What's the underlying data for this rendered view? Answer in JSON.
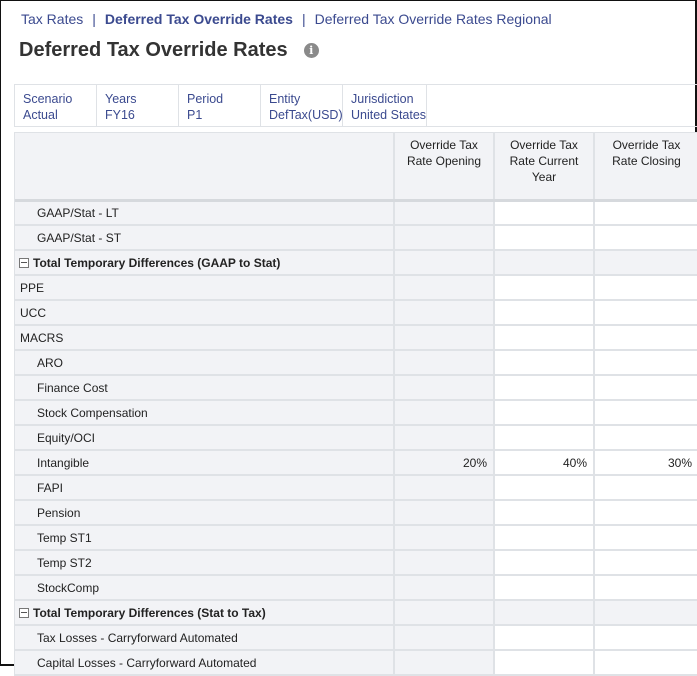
{
  "nav": {
    "links": [
      {
        "label": "Tax Rates",
        "active": false
      },
      {
        "label": "Deferred Tax Override Rates",
        "active": true
      },
      {
        "label": "Deferred Tax Override Rates Regional",
        "active": false
      }
    ],
    "separator": "|"
  },
  "page": {
    "title": "Deferred Tax Override Rates",
    "info_icon": "i"
  },
  "pov": [
    {
      "dimension": "Scenario",
      "member": "Actual"
    },
    {
      "dimension": "Years",
      "member": "FY16"
    },
    {
      "dimension": "Period",
      "member": "P1"
    },
    {
      "dimension": "Entity",
      "member": "DefTax(USD)"
    },
    {
      "dimension": "Jurisdiction",
      "member": "United States"
    }
  ],
  "grid": {
    "columns": [
      "Override Tax Rate Opening",
      "Override Tax Rate Current Year",
      "Override Tax Rate Closing"
    ],
    "rows": [
      {
        "label": "GAAP/Stat - LT",
        "indent": true,
        "section": false,
        "values": [
          "",
          "",
          ""
        ]
      },
      {
        "label": "GAAP/Stat - ST",
        "indent": true,
        "section": false,
        "values": [
          "",
          "",
          ""
        ]
      },
      {
        "label": "Total Temporary Differences (GAAP to Stat)",
        "indent": false,
        "section": true,
        "values": [
          "",
          "",
          ""
        ]
      },
      {
        "label": "PPE",
        "indent": false,
        "section": false,
        "values": [
          "",
          "",
          ""
        ]
      },
      {
        "label": "UCC",
        "indent": false,
        "section": false,
        "values": [
          "",
          "",
          ""
        ]
      },
      {
        "label": "MACRS",
        "indent": false,
        "section": false,
        "values": [
          "",
          "",
          ""
        ]
      },
      {
        "label": "ARO",
        "indent": true,
        "section": false,
        "values": [
          "",
          "",
          ""
        ]
      },
      {
        "label": "Finance Cost",
        "indent": true,
        "section": false,
        "values": [
          "",
          "",
          ""
        ]
      },
      {
        "label": "Stock Compensation",
        "indent": true,
        "section": false,
        "values": [
          "",
          "",
          ""
        ]
      },
      {
        "label": "Equity/OCI",
        "indent": true,
        "section": false,
        "values": [
          "",
          "",
          ""
        ]
      },
      {
        "label": "Intangible",
        "indent": true,
        "section": false,
        "values": [
          "20%",
          "40%",
          "30%"
        ]
      },
      {
        "label": "FAPI",
        "indent": true,
        "section": false,
        "values": [
          "",
          "",
          ""
        ]
      },
      {
        "label": "Pension",
        "indent": true,
        "section": false,
        "values": [
          "",
          "",
          ""
        ]
      },
      {
        "label": "Temp ST1",
        "indent": true,
        "section": false,
        "values": [
          "",
          "",
          ""
        ]
      },
      {
        "label": "Temp ST2",
        "indent": true,
        "section": false,
        "values": [
          "",
          "",
          ""
        ]
      },
      {
        "label": "StockComp",
        "indent": true,
        "section": false,
        "values": [
          "",
          "",
          ""
        ]
      },
      {
        "label": "Total Temporary Differences (Stat to Tax)",
        "indent": false,
        "section": true,
        "values": [
          "",
          "",
          ""
        ]
      },
      {
        "label": "Tax Losses - Carryforward Automated",
        "indent": true,
        "section": false,
        "values": [
          "",
          "",
          ""
        ]
      },
      {
        "label": "Capital Losses - Carryforward Automated",
        "indent": true,
        "section": false,
        "values": [
          "",
          "",
          ""
        ]
      }
    ]
  }
}
